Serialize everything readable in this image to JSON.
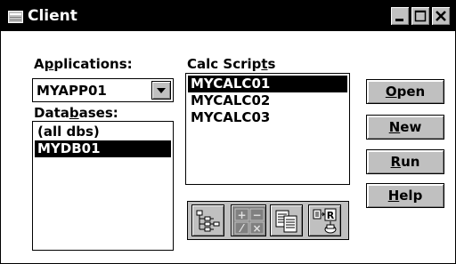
{
  "window": {
    "title": "Client"
  },
  "title_buttons": [
    {
      "name": "minimize",
      "glyph": "_"
    },
    {
      "name": "maximize",
      "glyph": "□"
    },
    {
      "name": "close",
      "glyph": "×"
    }
  ],
  "applications": {
    "label_pre": "A",
    "label_ul": "p",
    "label_post": "plications:",
    "selected": "MYAPP01"
  },
  "databases": {
    "label_pre": "Data",
    "label_ul": "b",
    "label_post": "ases:",
    "items": [
      "(all dbs)",
      "MYDB01"
    ],
    "selected_index": 1
  },
  "calc_scripts": {
    "label_pre": "Calc Scrip",
    "label_ul": "t",
    "label_post": "s",
    "items": [
      "MYCALC01",
      "MYCALC02",
      "MYCALC03"
    ],
    "selected_index": 0
  },
  "buttons": {
    "open": {
      "ul": "O",
      "rest": "pen"
    },
    "new": {
      "ul": "N",
      "rest": "ew"
    },
    "run": {
      "ul": "R",
      "rest": "un"
    },
    "help": {
      "ul": "H",
      "rest": "elp"
    }
  },
  "toolbar": {
    "icons": [
      "outline-icon",
      "calculator-icon",
      "copy-icon",
      "report-icon"
    ],
    "calc_glyphs": [
      "+",
      "−",
      "⁄",
      "×"
    ]
  }
}
